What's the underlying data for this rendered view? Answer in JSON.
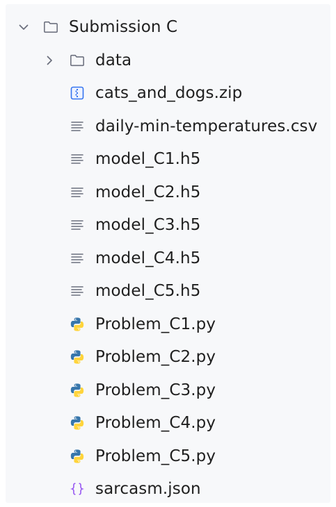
{
  "tree": {
    "root": {
      "label": "Submission C",
      "icon": "folder-icon",
      "expanded": true,
      "children": [
        {
          "label": "data",
          "type": "folder",
          "icon": "folder-icon",
          "expanded": false
        },
        {
          "label": "cats_and_dogs.zip",
          "type": "zip",
          "icon": "zip-archive-icon"
        },
        {
          "label": "daily-min-temperatures.csv",
          "type": "text",
          "icon": "text-file-icon"
        },
        {
          "label": "model_C1.h5",
          "type": "text",
          "icon": "text-file-icon"
        },
        {
          "label": "model_C2.h5",
          "type": "text",
          "icon": "text-file-icon"
        },
        {
          "label": "model_C3.h5",
          "type": "text",
          "icon": "text-file-icon"
        },
        {
          "label": "model_C4.h5",
          "type": "text",
          "icon": "text-file-icon"
        },
        {
          "label": "model_C5.h5",
          "type": "text",
          "icon": "text-file-icon"
        },
        {
          "label": "Problem_C1.py",
          "type": "python",
          "icon": "python-file-icon"
        },
        {
          "label": "Problem_C2.py",
          "type": "python",
          "icon": "python-file-icon"
        },
        {
          "label": "Problem_C3.py",
          "type": "python",
          "icon": "python-file-icon"
        },
        {
          "label": "Problem_C4.py",
          "type": "python",
          "icon": "python-file-icon"
        },
        {
          "label": "Problem_C5.py",
          "type": "python",
          "icon": "python-file-icon"
        },
        {
          "label": "sarcasm.json",
          "type": "json",
          "icon": "json-file-icon"
        }
      ]
    }
  },
  "colors": {
    "panel_bg": "#f7f8fa",
    "text": "#1f1f1f",
    "icon_stroke": "#6c707e",
    "zip_blue": "#3574f0",
    "json_purple": "#9a5cf2",
    "python_blue": "#3776ab",
    "python_yellow": "#ffd43b"
  }
}
